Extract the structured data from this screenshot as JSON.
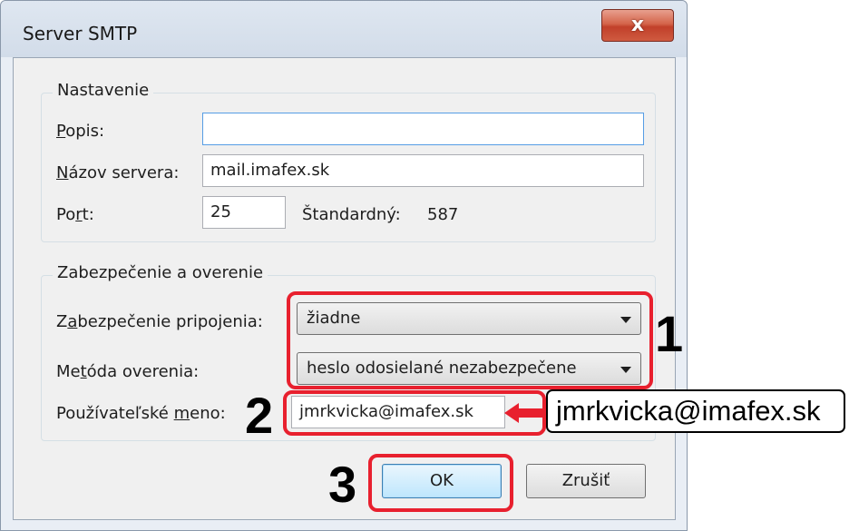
{
  "window": {
    "title": "Server SMTP",
    "close_glyph": "x"
  },
  "settings_group": {
    "title": "Nastavenie",
    "description": {
      "label_pre": "",
      "label_u": "P",
      "label_post": "opis:",
      "value": ""
    },
    "server_name": {
      "label_pre": "",
      "label_u": "N",
      "label_post": "ázov servera:",
      "value": "mail.imafex.sk"
    },
    "port": {
      "label_pre": "Po",
      "label_u": "r",
      "label_post": "t:",
      "value": "25",
      "default_label": "Štandardný:",
      "default_value": "587"
    }
  },
  "security_group": {
    "title": "Zabezpečenie a overenie",
    "connection_security": {
      "label_pre": "Z",
      "label_u": "a",
      "label_post": "bezpečenie pripojenia:",
      "value": "žiadne"
    },
    "auth_method": {
      "label_pre": "Me",
      "label_u": "t",
      "label_post": "óda overenia:",
      "value": "heslo odosielané nezabezpečene"
    },
    "username": {
      "label_pre": "Používateľské ",
      "label_u": "m",
      "label_post": "eno:",
      "value": "jmrkvicka@imafex.sk"
    }
  },
  "buttons": {
    "ok": "OK",
    "cancel": "Zrušiť"
  },
  "annotations": {
    "step1": "1",
    "step2": "2",
    "step3": "3",
    "callout_text": "jmrkvicka@imafex.sk",
    "highlight_color": "#e8202e"
  }
}
